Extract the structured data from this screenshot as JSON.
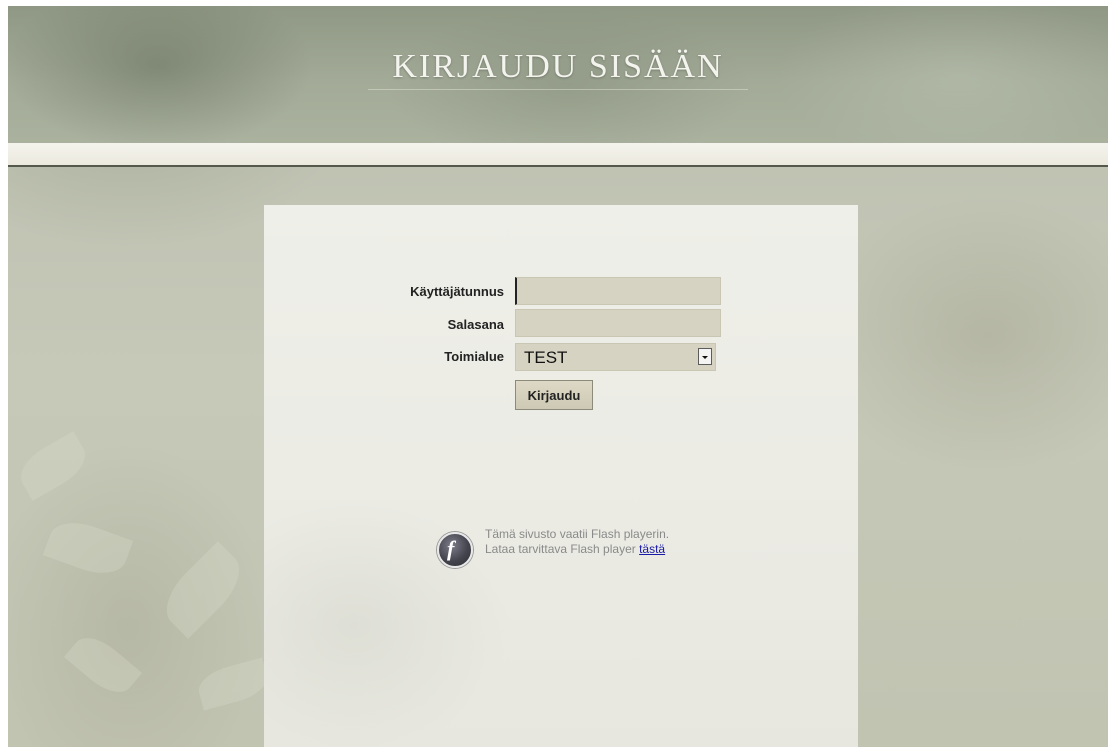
{
  "header": {
    "title": "KIRJAUDU SISÄÄN"
  },
  "form": {
    "username_label": "Käyttäjätunnus",
    "username_value": "",
    "password_label": "Salasana",
    "password_value": "",
    "domain_label": "Toimialue",
    "domain_selected": "TEST",
    "submit_label": "Kirjaudu"
  },
  "flash_notice": {
    "line1": "Tämä sivusto vaatii Flash playerin.",
    "line2": "Lataa tarvittava Flash player",
    "link_text": "tästä",
    "icon": "flash-player-icon"
  },
  "colors": {
    "header_bg": "#9ea692",
    "page_bg": "#c3c5b5",
    "panel_bg": "#ededE6",
    "field_bg": "#d6d3c2",
    "link": "#1a1aa8"
  }
}
